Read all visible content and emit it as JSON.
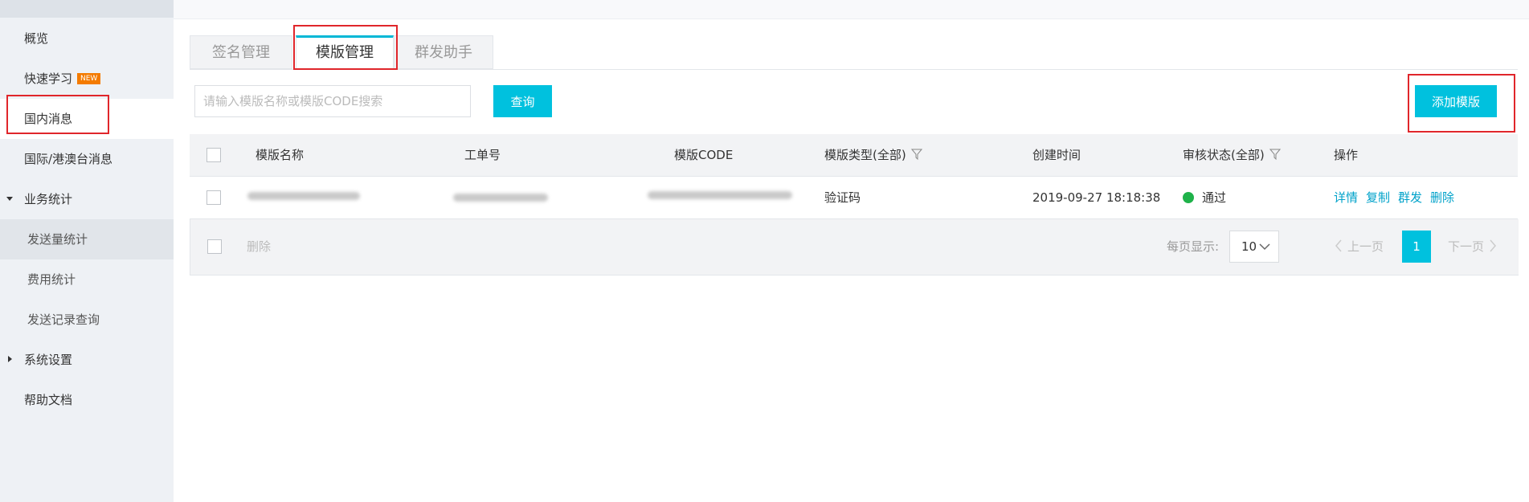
{
  "sidebar": {
    "items": [
      {
        "label": "概览"
      },
      {
        "label": "快速学习",
        "badge": "NEW"
      },
      {
        "label": "国内消息"
      },
      {
        "label": "国际/港澳台消息"
      },
      {
        "label": "业务统计"
      },
      {
        "label": "发送量统计"
      },
      {
        "label": "费用统计"
      },
      {
        "label": "发送记录查询"
      },
      {
        "label": "系统设置"
      },
      {
        "label": "帮助文档"
      }
    ]
  },
  "tabs": [
    {
      "label": "签名管理"
    },
    {
      "label": "模版管理"
    },
    {
      "label": "群发助手"
    }
  ],
  "search": {
    "placeholder": "请输入模版名称或模版CODE搜索",
    "button_label": "查询"
  },
  "add_button_label": "添加模版",
  "table": {
    "headers": {
      "name": "模版名称",
      "ticket": "工单号",
      "code": "模版CODE",
      "type": "模版类型(全部)",
      "created": "创建时间",
      "status": "审核状态(全部)",
      "actions": "操作"
    },
    "rows": [
      {
        "type": "验证码",
        "created": "2019-09-27 18:18:38",
        "status": "通过",
        "status_color": "#1fb24a",
        "actions": [
          "详情",
          "复制",
          "群发",
          "删除"
        ]
      }
    ]
  },
  "footer": {
    "delete_label": "删除",
    "per_page_label": "每页显示:",
    "per_page_value": "10",
    "prev_label": "上一页",
    "next_label": "下一页",
    "current_page": "1"
  },
  "colors": {
    "accent": "#00c1de",
    "highlight_box": "#e0262b"
  }
}
